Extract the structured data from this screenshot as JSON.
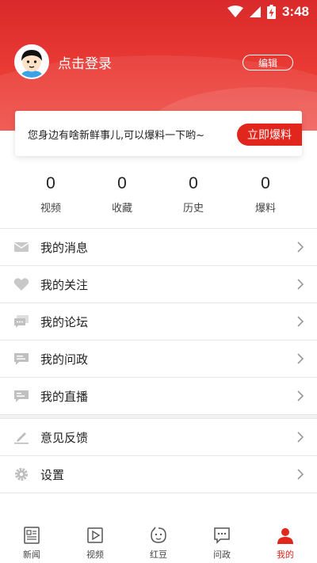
{
  "status_bar": {
    "time": "3:48"
  },
  "profile": {
    "login_text": "点击登录",
    "edit_label": "编辑"
  },
  "tip": {
    "text": "您身边有啥新鲜事儿,可以爆料一下哟~",
    "button_label": "立即爆料"
  },
  "stats": [
    {
      "value": "0",
      "label": "视频"
    },
    {
      "value": "0",
      "label": "收藏"
    },
    {
      "value": "0",
      "label": "历史"
    },
    {
      "value": "0",
      "label": "爆料"
    }
  ],
  "menu": {
    "group1": [
      {
        "label": "我的消息",
        "icon": "envelope-icon"
      },
      {
        "label": "我的关注",
        "icon": "heart-icon"
      },
      {
        "label": "我的论坛",
        "icon": "forum-icon"
      },
      {
        "label": "我的问政",
        "icon": "chat-icon"
      },
      {
        "label": "我的直播",
        "icon": "live-icon"
      }
    ],
    "group2": [
      {
        "label": "意见反馈",
        "icon": "feedback-icon"
      },
      {
        "label": "设置",
        "icon": "settings-icon"
      }
    ]
  },
  "bottom_nav": [
    {
      "label": "新闻",
      "icon": "news-icon",
      "active": false
    },
    {
      "label": "视频",
      "icon": "video-icon",
      "active": false
    },
    {
      "label": "红豆",
      "icon": "hongdou-icon",
      "active": false
    },
    {
      "label": "问政",
      "icon": "wenzheng-icon",
      "active": false
    },
    {
      "label": "我的",
      "icon": "profile-icon",
      "active": true
    }
  ],
  "colors": {
    "brand_red": "#e0261d",
    "header_red": "#e3322f"
  }
}
